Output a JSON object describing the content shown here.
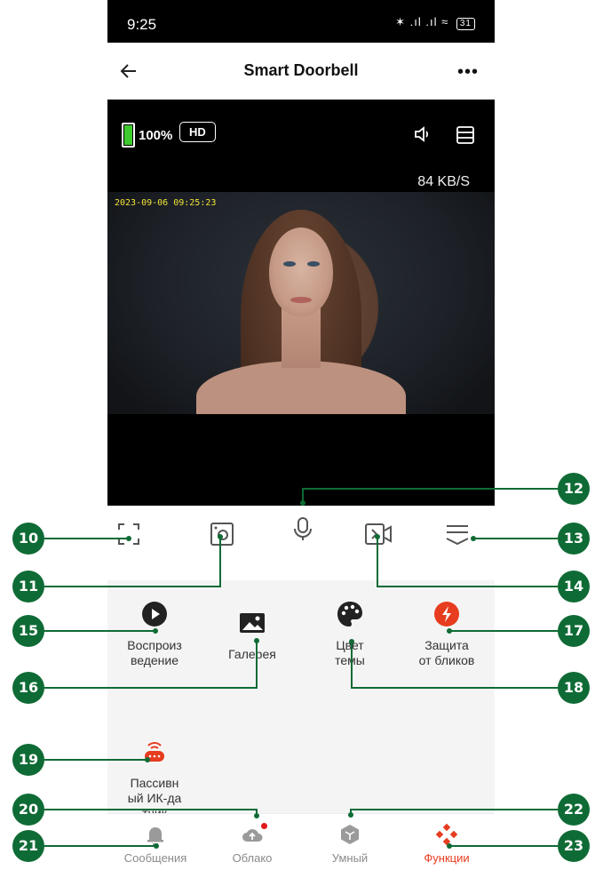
{
  "status": {
    "time": "9:25",
    "icons": "✶ .ıl .ıl",
    "battery": "31"
  },
  "header": {
    "title": "Smart Doorbell",
    "more": "•••"
  },
  "video": {
    "battery": "100%",
    "quality": "HD",
    "speed": "84 KB/S",
    "timestamp": "2023-09-06 09:25:23"
  },
  "functions": [
    {
      "label": "Воспроиз\nведение",
      "icon": "play-icon"
    },
    {
      "label": "Галерея",
      "icon": "gallery-icon"
    },
    {
      "label": "Цвет\nтемы",
      "icon": "palette-icon"
    },
    {
      "label": "Защита\nот бликов",
      "icon": "flash-icon"
    },
    {
      "label": "Пассивн\nый ИК-да\nтчик",
      "icon": "pir-sensor-icon"
    }
  ],
  "nav": [
    {
      "label": "Сообщения",
      "icon": "bell-icon"
    },
    {
      "label": "Облако",
      "icon": "cloud-icon"
    },
    {
      "label": "Умный",
      "icon": "smart-cube-icon"
    },
    {
      "label": "Функции",
      "icon": "functions-icon"
    }
  ],
  "colors": {
    "accent": "#e73c1f",
    "callout": "#0f6b35",
    "battery": "#3ecb2e",
    "timestamp": "#f3e23a"
  },
  "callouts": [
    "10",
    "11",
    "12",
    "13",
    "14",
    "15",
    "16",
    "17",
    "18",
    "19",
    "20",
    "21",
    "22",
    "23"
  ]
}
